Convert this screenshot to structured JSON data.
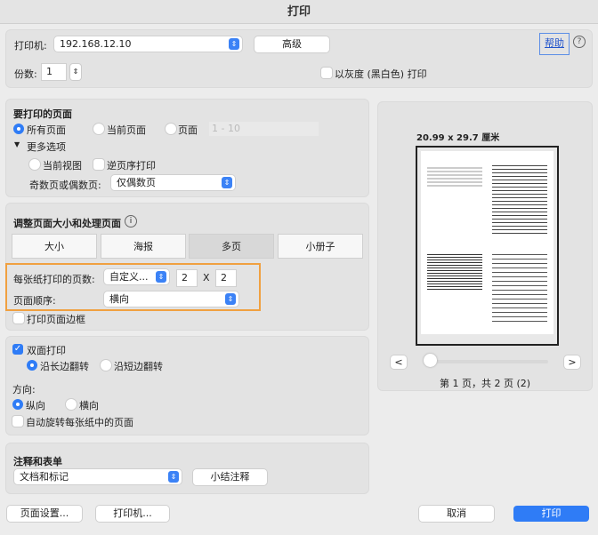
{
  "title": "打印",
  "printer": {
    "label": "打印机:",
    "value": "192.168.12.10",
    "advanced": "高级",
    "help": "帮助",
    "help_icon": "question-circle-icon"
  },
  "copies": {
    "label": "份数:",
    "value": "1",
    "grayscale": "以灰度 (黑白色) 打印"
  },
  "pages": {
    "heading": "要打印的页面",
    "all": "所有页面",
    "current": "当前页面",
    "range_label": "页面",
    "range_placeholder": "1 - 10",
    "more": "更多选项",
    "current_view": "当前视图",
    "reverse": "逆页序打印",
    "odd_even_label": "奇数页或偶数页:",
    "odd_even_value": "仅偶数页"
  },
  "sizing": {
    "heading": "调整页面大小和处理页面",
    "tabs": [
      "大小",
      "海报",
      "多页",
      "小册子"
    ],
    "selected_tab": "多页",
    "per_sheet_label": "每张纸打印的页数:",
    "per_sheet_value": "自定义...",
    "cols": "2",
    "x": "X",
    "rows": "2",
    "order_label": "页面顺序:",
    "order_value": "横向",
    "border": "打印页面边框"
  },
  "duplex": {
    "label": "双面打印",
    "checked": true,
    "long": "沿长边翻转",
    "short": "沿短边翻转",
    "orientation_label": "方向:",
    "portrait": "纵向",
    "landscape": "横向",
    "autorotate": "自动旋转每张纸中的页面"
  },
  "comments": {
    "heading": "注释和表单",
    "value": "文档和标记",
    "summary": "小结注释"
  },
  "preview": {
    "size": "20.99 x 29.7 厘米",
    "prev": "<",
    "next": ">",
    "page_info": "第 1 页，共 2 页 (2)",
    "slider_fraction": 0
  },
  "footer": {
    "page_setup": "页面设置...",
    "printer": "打印机...",
    "cancel": "取消",
    "print": "打印"
  },
  "colors": {
    "accent": "#2f7cf6",
    "highlight": "#f0a040"
  }
}
